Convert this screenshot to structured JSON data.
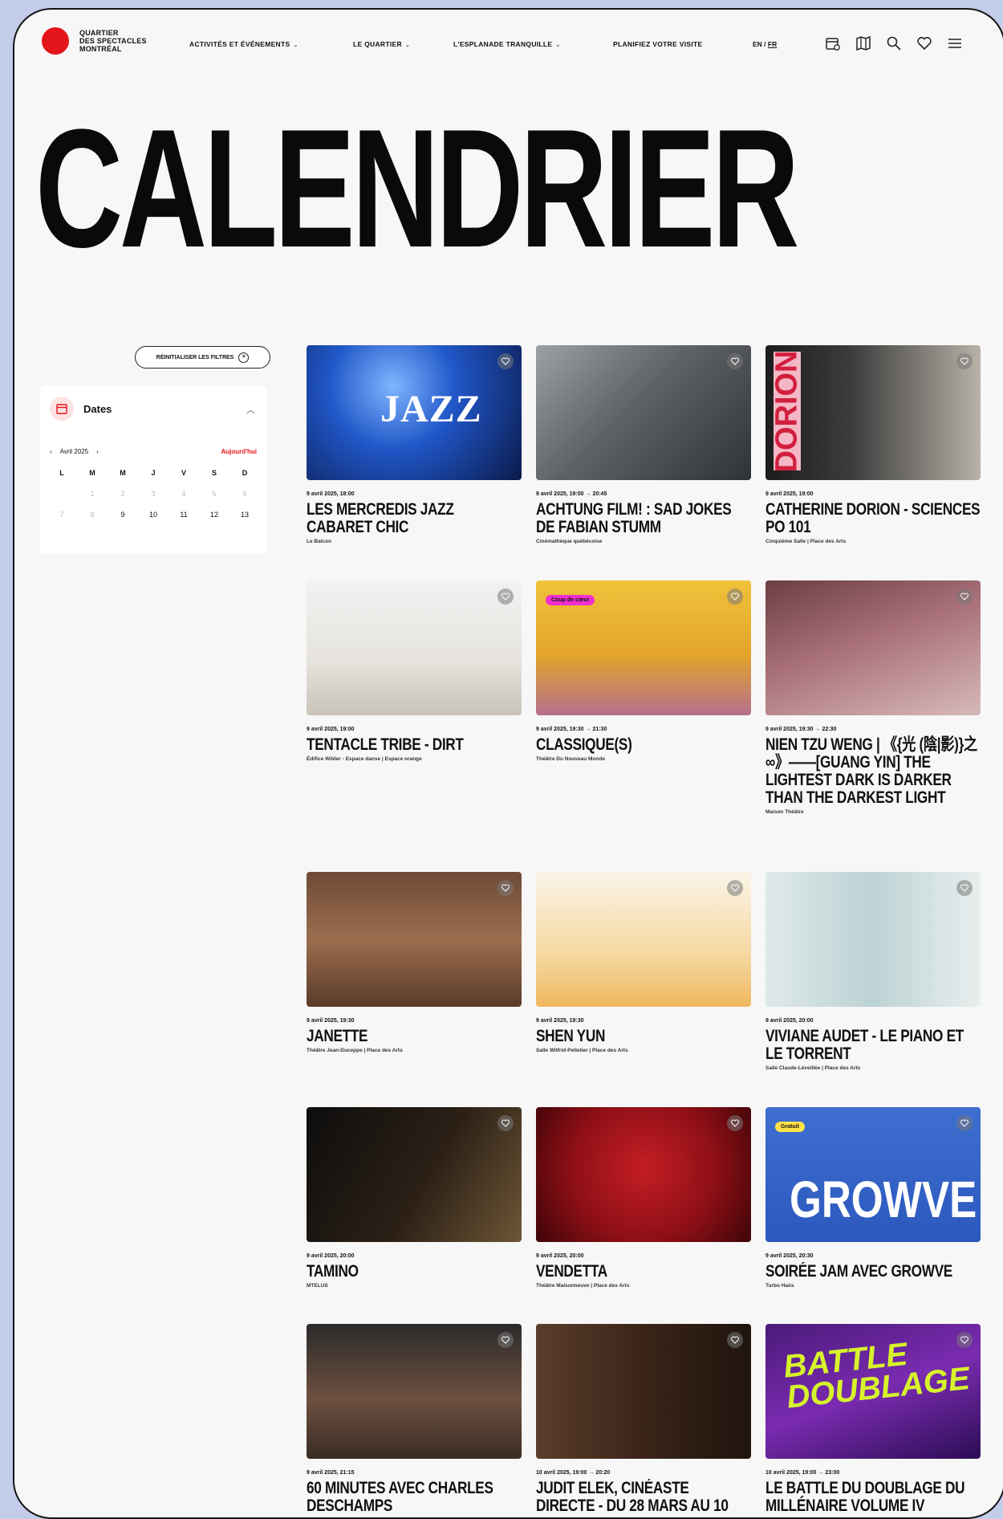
{
  "logo": {
    "lines": [
      "QUARTIER",
      "DES SPECTACLES",
      "MONTRÉAL"
    ]
  },
  "nav": [
    {
      "label": "ACTIVITÉS ET ÉVÉNEMENTS",
      "chevron": "⌄"
    },
    {
      "label": "LE QUARTIER",
      "chevron": "⌄"
    },
    {
      "label": "L'ESPLANADE TRANQUILLE",
      "chevron": "⌄"
    },
    {
      "label": "PLANIFIEZ VOTRE VISITE",
      "chevron": ""
    }
  ],
  "lang": {
    "en": "EN",
    "sep": " / ",
    "fr": "FR"
  },
  "page_title": "CALENDRIER",
  "filters": {
    "reset_label": "RÉINITIALISER LES FILTRES",
    "dates_label": "Dates"
  },
  "calendar": {
    "month": "Avril 2025",
    "today": "Aujourd'hui",
    "prev": "‹",
    "next": "›",
    "day_headers": [
      "L",
      "M",
      "M",
      "J",
      "V",
      "S",
      "D"
    ],
    "days": [
      "",
      "1",
      "2",
      "3",
      "4",
      "5",
      "6",
      "7",
      "8",
      "9",
      "10",
      "11",
      "12",
      "13"
    ]
  },
  "events": [
    {
      "date": "9 avril 2025, 18:00",
      "title": "LES MERCREDIS JAZZ CABARET CHIC",
      "venue": "Le Balcon",
      "overlay": "JAZZ"
    },
    {
      "date": "9 avril 2025, 19:00 → 20:45",
      "title": "ACHTUNG FILM! : SAD JOKES DE FABIAN STUMM",
      "venue": "Cinémathèque québécoise"
    },
    {
      "date": "9 avril 2025, 19:00",
      "title": "CATHERINE DORION - SCIENCES PO 101",
      "venue": "Cinquième Salle | Place des Arts",
      "overlay": "DORION"
    },
    {
      "date": "9 avril 2025, 19:00",
      "title": "TENTACLE TRIBE - DIRT",
      "venue": "Édifice Wilder - Espace danse | Espace orange"
    },
    {
      "date": "9 avril 2025, 19:30 → 21:30",
      "title": "CLASSIQUE(S)",
      "venue": "Théâtre Du Nouveau Monde",
      "badge": "Coup de cœur"
    },
    {
      "date": "9 avril 2025, 19:30 → 22:30",
      "title": "NIEN TZU WENG | 《{光 (陰|影)}之∞》——[GUANG YIN] THE LIGHTEST DARK IS DARKER THAN THE DARKEST LIGHT",
      "venue": "Maison Théâtre"
    },
    {
      "date": "9 avril 2025, 19:30",
      "title": "JANETTE",
      "venue": "Théâtre Jean-Duceppe | Place des Arts"
    },
    {
      "date": "9 avril 2025, 19:30",
      "title": "SHEN YUN",
      "venue": "Salle Wilfrid-Pelletier | Place des Arts"
    },
    {
      "date": "9 avril 2025, 20:00",
      "title": "VIVIANE AUDET - LE PIANO ET LE TORRENT",
      "venue": "Salle Claude-Léveillée | Place des Arts"
    },
    {
      "date": "9 avril 2025, 20:00",
      "title": "TAMINO",
      "venue": "MTELUS"
    },
    {
      "date": "9 avril 2025, 20:00",
      "title": "VENDETTA",
      "venue": "Théâtre Maisonneuve | Place des Arts"
    },
    {
      "date": "9 avril 2025, 20:30",
      "title": "SOIRÉE JAM AVEC GROWVE",
      "venue": "Turbo Haüs",
      "badge": "Gratuit",
      "overlay": "GROWVE"
    },
    {
      "date": "9 avril 2025, 21:15",
      "title": "60 MINUTES AVEC CHARLES DESCHAMPS",
      "venue": ""
    },
    {
      "date": "10 avril 2025, 19:00 → 20:20",
      "title": "JUDIT ELEK, CINÉASTE DIRECTE - DU 28 MARS AU 10",
      "venue": ""
    },
    {
      "date": "10 avril 2025, 19:00 → 23:00",
      "title": "LE BATTLE DU DOUBLAGE DU MILLÉNAIRE VOLUME IV",
      "venue": "",
      "overlay": "BATTLE DOUBLAGE"
    }
  ],
  "colors": {
    "brand_red": "#e4141b",
    "background": "#f7f7f7",
    "outer_background": "#c3cce9"
  }
}
